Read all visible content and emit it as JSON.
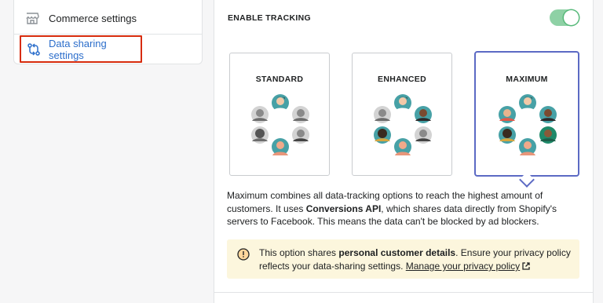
{
  "sidebar": {
    "items": [
      {
        "label": "Commerce settings",
        "icon": "store-icon"
      },
      {
        "label": "Data sharing settings",
        "icon": "data-sharing-icon",
        "active": true
      }
    ]
  },
  "tracking": {
    "label": "ENABLE TRACKING",
    "enabled": true
  },
  "options": [
    {
      "title": "STANDARD",
      "selected": false
    },
    {
      "title": "ENHANCED",
      "selected": false
    },
    {
      "title": "MAXIMUM",
      "selected": true
    }
  ],
  "description": {
    "part1": "Maximum combines all data-tracking options to reach the highest amount of customers. It uses ",
    "bold": "Conversions API",
    "part2": ", which shares data directly from Shopify's servers to Facebook. This means the data can't be blocked by ad blockers."
  },
  "banner": {
    "part1": "This option shares ",
    "bold": "personal customer details",
    "part2": ". Ensure your privacy policy reflects your data-sharing settings. ",
    "link": "Manage your privacy policy"
  },
  "colors": {
    "accent": "#5c6ac4",
    "link": "#2c6ecb",
    "highlight": "#d72c0d",
    "toggle_on": "#8ed1a5",
    "banner_bg": "#fcf6dd",
    "teal": "#47a1a6"
  }
}
